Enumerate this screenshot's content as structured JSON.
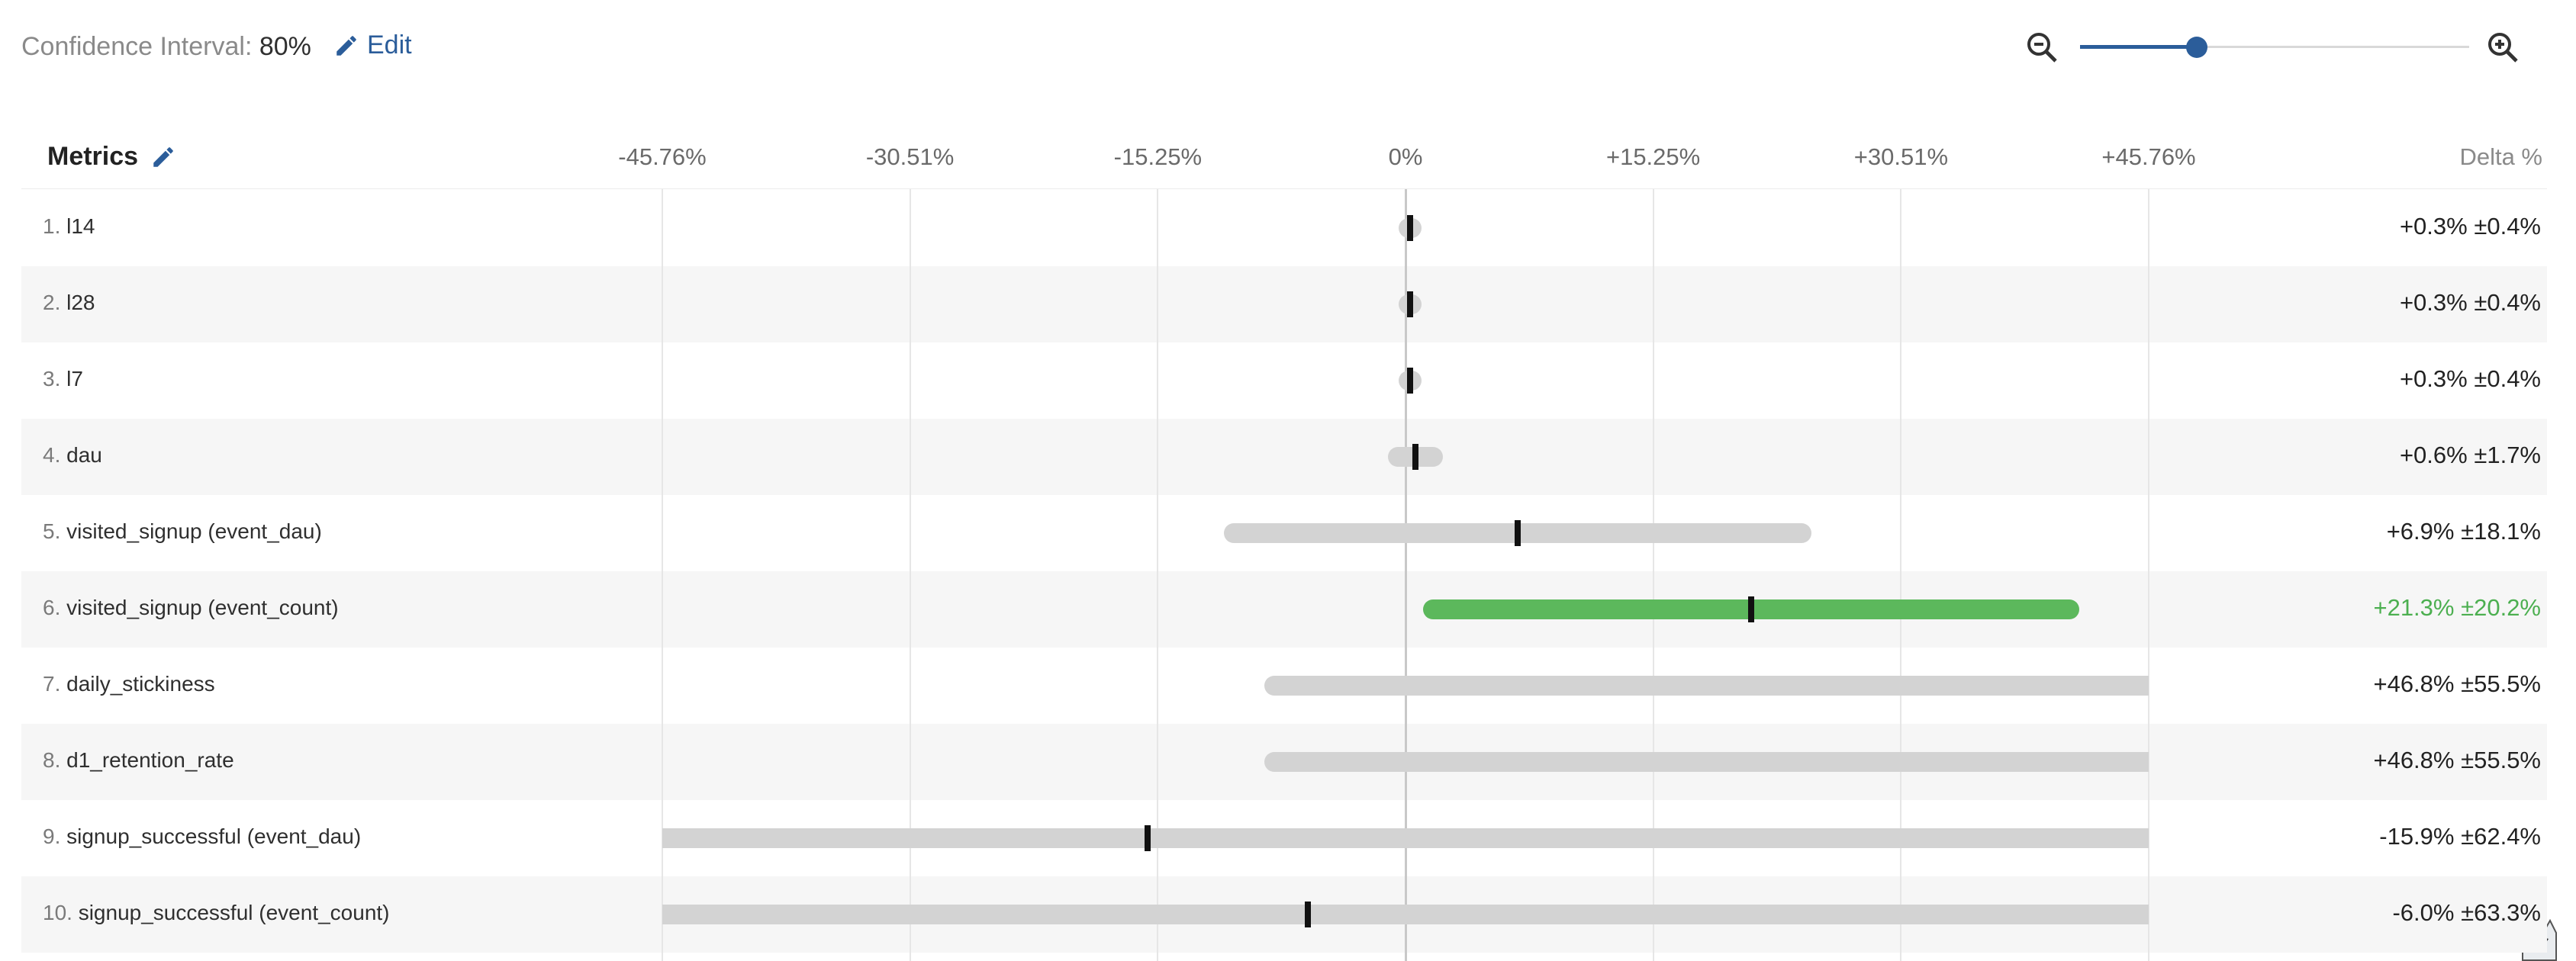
{
  "confidence": {
    "label": "Confidence Interval:",
    "value": "80%",
    "edit_label": "Edit"
  },
  "zoom": {
    "level": 0.3
  },
  "header": {
    "metrics_label": "Metrics",
    "delta_label": "Delta %"
  },
  "axis": {
    "ticks": [
      "-45.76%",
      "-30.51%",
      "-15.25%",
      "0%",
      "+15.25%",
      "+30.51%",
      "+45.76%"
    ],
    "tick_values": [
      -45.76,
      -30.51,
      -15.25,
      0,
      15.25,
      30.51,
      45.76
    ],
    "min": -45.76,
    "max": 45.76
  },
  "rows": [
    {
      "index": "1.",
      "name": "l14",
      "delta_text": "+0.3% ±0.4%",
      "delta": 0.3,
      "ci": 0.4,
      "significant": false
    },
    {
      "index": "2.",
      "name": "l28",
      "delta_text": "+0.3% ±0.4%",
      "delta": 0.3,
      "ci": 0.4,
      "significant": false
    },
    {
      "index": "3.",
      "name": "l7",
      "delta_text": "+0.3% ±0.4%",
      "delta": 0.3,
      "ci": 0.4,
      "significant": false
    },
    {
      "index": "4.",
      "name": "dau",
      "delta_text": "+0.6% ±1.7%",
      "delta": 0.6,
      "ci": 1.7,
      "significant": false
    },
    {
      "index": "5.",
      "name": "visited_signup (event_dau)",
      "delta_text": "+6.9% ±18.1%",
      "delta": 6.9,
      "ci": 18.1,
      "significant": false
    },
    {
      "index": "6.",
      "name": "visited_signup (event_count)",
      "delta_text": "+21.3% ±20.2%",
      "delta": 21.3,
      "ci": 20.2,
      "significant": true
    },
    {
      "index": "7.",
      "name": "daily_stickiness",
      "delta_text": "+46.8% ±55.5%",
      "delta": 46.8,
      "ci": 55.5,
      "significant": false
    },
    {
      "index": "8.",
      "name": "d1_retention_rate",
      "delta_text": "+46.8% ±55.5%",
      "delta": 46.8,
      "ci": 55.5,
      "significant": false
    },
    {
      "index": "9.",
      "name": "signup_successful (event_dau)",
      "delta_text": "-15.9% ±62.4%",
      "delta": -15.9,
      "ci": 62.4,
      "significant": false
    },
    {
      "index": "10.",
      "name": "signup_successful (event_count)",
      "delta_text": "-6.0% ±63.3%",
      "delta": -6.0,
      "ci": 63.3,
      "significant": false
    }
  ],
  "colors": {
    "accent": "#2b5d9a",
    "significant": "#5cb85c",
    "bar": "#d3d3d3"
  }
}
